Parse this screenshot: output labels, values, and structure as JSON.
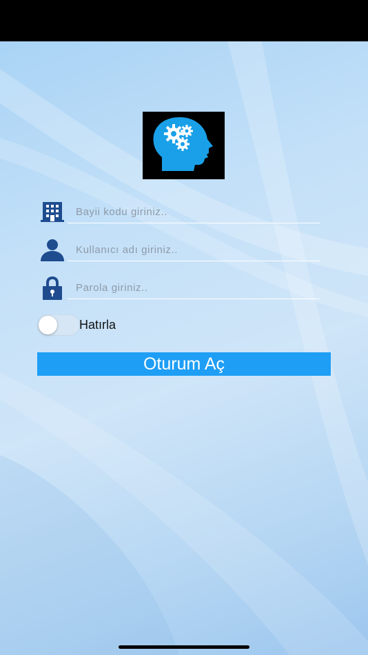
{
  "form": {
    "dealer_code": {
      "placeholder": "Bayii kodu giriniz..",
      "value": "",
      "icon": "building-icon"
    },
    "username": {
      "placeholder": "Kullanıcı adı giriniz..",
      "value": "",
      "icon": "user-icon"
    },
    "password": {
      "placeholder": "Parola giriniz..",
      "value": "",
      "icon": "lock-icon"
    }
  },
  "remember": {
    "label": "Hatırla",
    "checked": false
  },
  "login_button": {
    "label": "Oturum Aç"
  },
  "logo": {
    "icon": "brain-gears-icon"
  },
  "colors": {
    "accent": "#1e9ef5",
    "icon": "#1e4c8f",
    "logo_head": "#1aa0e8",
    "background": "#c3e0f8"
  }
}
